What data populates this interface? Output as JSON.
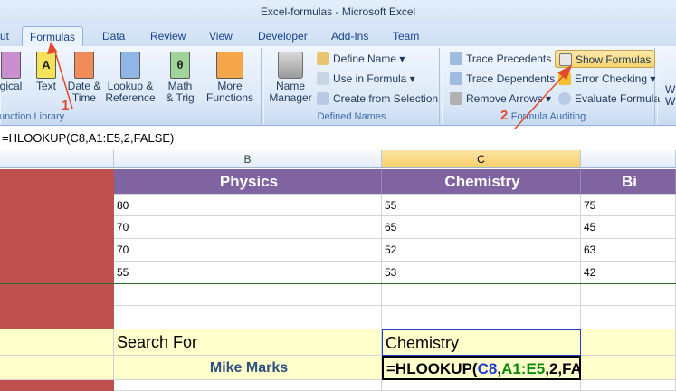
{
  "window": {
    "title": "Excel-formulas - Microsoft Excel"
  },
  "tabs": [
    {
      "label": "ut"
    },
    {
      "label": "Formulas"
    },
    {
      "label": "Data"
    },
    {
      "label": "Review"
    },
    {
      "label": "View"
    },
    {
      "label": "Developer"
    },
    {
      "label": "Add-Ins"
    },
    {
      "label": "Team"
    }
  ],
  "ribbon": {
    "function_library": {
      "label": "unction Library",
      "buttons": [
        {
          "line1": "gical",
          "line2": ""
        },
        {
          "line1": "Text",
          "line2": ""
        },
        {
          "line1": "Date &",
          "line2": "Time"
        },
        {
          "line1": "Lookup &",
          "line2": "Reference"
        },
        {
          "line1": "Math",
          "line2": "& Trig"
        },
        {
          "line1": "More",
          "line2": "Functions"
        }
      ],
      "math_glyph": "θ",
      "text_glyph": "A"
    },
    "defined_names": {
      "label": "Defined Names",
      "name_manager_line1": "Name",
      "name_manager_line2": "Manager",
      "define_name": "Define Name",
      "use_in_formula": "Use in Formula",
      "create_from_selection": "Create from Selection"
    },
    "formula_auditing": {
      "label": "Formula Auditing",
      "trace_precedents": "Trace Precedents",
      "trace_dependents": "Trace Dependents",
      "remove_arrows": "Remove Arrows",
      "show_formulas": "Show Formulas",
      "error_checking": "Error Checking",
      "evaluate_formula": "Evaluate Formula",
      "watch_line1": "W",
      "watch_line2": "Wi"
    }
  },
  "annotations": {
    "one": "1",
    "two": "2"
  },
  "formula_bar": {
    "value": "=HLOOKUP(C8,A1:E5,2,FALSE)"
  },
  "columns": [
    {
      "label": "B"
    },
    {
      "label": "C"
    }
  ],
  "sheet": {
    "headers": {
      "b": "Physics",
      "c": "Chemistry",
      "d": "Bi"
    },
    "rows": [
      {
        "b": "80",
        "c": "55",
        "d": "75"
      },
      {
        "b": "70",
        "c": "65",
        "d": "45"
      },
      {
        "b": "70",
        "c": "52",
        "d": "63"
      },
      {
        "b": "55",
        "c": "53",
        "d": "42"
      }
    ],
    "search_for_label": "Search For",
    "search_for_value": "Chemistry",
    "marks_label": "Mike Marks",
    "formula_parts": {
      "p1": "=HLOOKUP(",
      "p2": "C8",
      "p3": ",",
      "p4": "A1:E5",
      "p5": ",2,FA"
    }
  },
  "colors": {
    "red_column": "#c0504d",
    "purple_header": "#8064a2",
    "input_yellow": "#ffffcc",
    "ref_blue": "#1f3ccf",
    "ref_green": "#0b8a0b",
    "annotation": "#e24a2b"
  }
}
